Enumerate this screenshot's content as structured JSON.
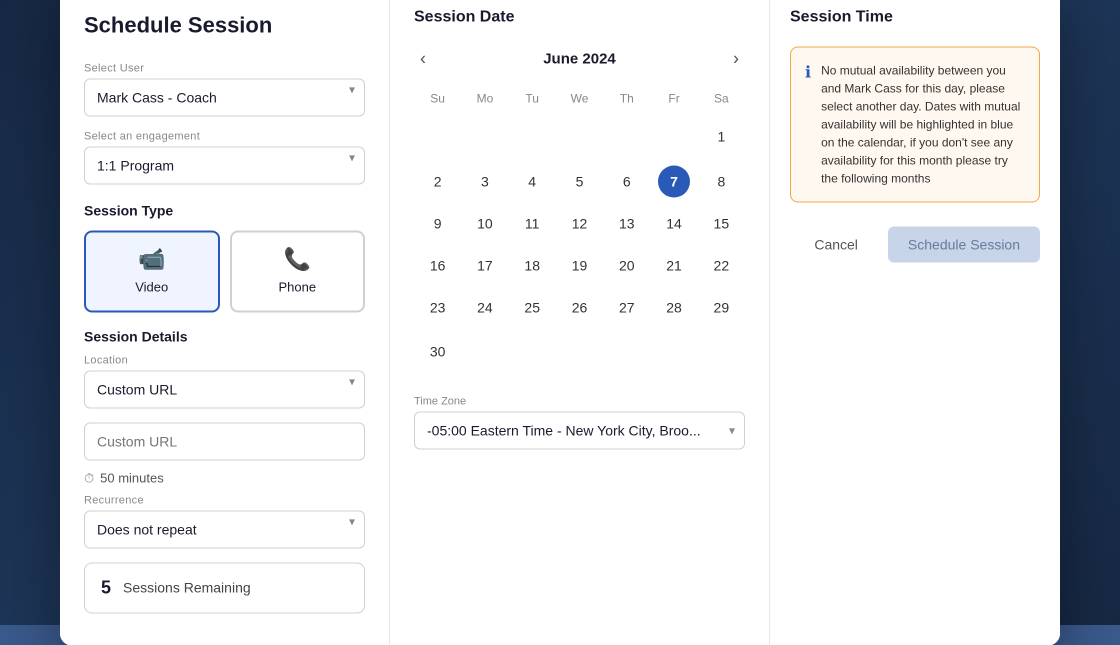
{
  "modal": {
    "title": "Schedule Session",
    "left": {
      "select_user_label": "Select User",
      "select_user_value": "Mark Cass  - Coach",
      "select_engagement_label": "Select an engagement",
      "select_engagement_value": "1:1 Program",
      "session_type_title": "Session Type",
      "session_types": [
        {
          "id": "video",
          "icon": "📹",
          "label": "Video",
          "active": true
        },
        {
          "id": "phone",
          "icon": "📞",
          "label": "Phone",
          "active": false
        }
      ],
      "session_details_title": "Session Details",
      "location_label": "Location",
      "location_value": "Custom URL",
      "custom_url_placeholder": "Custom URL",
      "duration_icon": "⏱",
      "duration_text": "50 minutes",
      "recurrence_label": "Recurrence",
      "recurrence_value": "Does not repeat",
      "sessions_remaining_num": "5",
      "sessions_remaining_label": "Sessions Remaining"
    },
    "middle": {
      "title": "Session Date",
      "month": "June 2024",
      "day_headers": [
        "Su",
        "Mo",
        "Tu",
        "We",
        "Th",
        "Fr",
        "Sa"
      ],
      "weeks": [
        [
          null,
          null,
          null,
          null,
          null,
          null,
          1
        ],
        [
          2,
          3,
          4,
          5,
          6,
          7,
          8
        ],
        [
          9,
          10,
          11,
          12,
          13,
          14,
          15
        ],
        [
          16,
          17,
          18,
          19,
          20,
          21,
          22
        ],
        [
          23,
          24,
          25,
          26,
          27,
          28,
          29
        ],
        [
          30,
          null,
          null,
          null,
          null,
          null,
          null
        ]
      ],
      "selected_day": 7,
      "timezone_label": "Time Zone",
      "timezone_value": "-05:00 Eastern Time - New York City, Broo..."
    },
    "right": {
      "title": "Session Time",
      "info_text": "No mutual availability between you and Mark Cass for this day, please select another day. Dates with mutual availability will be highlighted in blue on the calendar, if you don't see any availability for this month please try the following months",
      "cancel_label": "Cancel",
      "schedule_label": "Schedule Session"
    }
  }
}
